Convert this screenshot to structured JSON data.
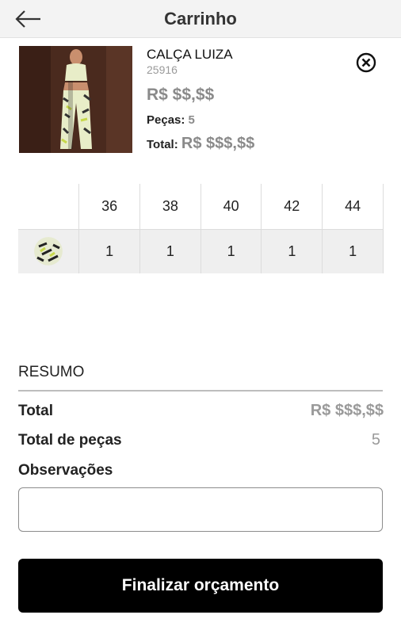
{
  "header": {
    "title": "Carrinho",
    "back_icon": "arrow-left-icon"
  },
  "product": {
    "name": "CALÇA LUIZA",
    "sku": "25916",
    "price": "R$ $$,$$",
    "pieces_label": "Peças:",
    "pieces_value": "5",
    "total_label": "Total:",
    "total_value": "R$ $$$,$$",
    "remove_icon": "close-circle-icon"
  },
  "grid": {
    "sizes": [
      "36",
      "38",
      "40",
      "42",
      "44"
    ],
    "quantities": [
      "1",
      "1",
      "1",
      "1",
      "1"
    ]
  },
  "summary": {
    "heading": "RESUMO",
    "total_label": "Total",
    "total_value": "R$ $$$,$$",
    "pieces_label": "Total de peças",
    "pieces_value": "5",
    "notes_label": "Observações",
    "notes_value": "",
    "notes_placeholder": ""
  },
  "actions": {
    "finish_label": "Finalizar orçamento"
  },
  "colors": {
    "button_bg": "#000000",
    "header_bg": "#f3f3f3",
    "muted_text": "#8a8a8a"
  }
}
